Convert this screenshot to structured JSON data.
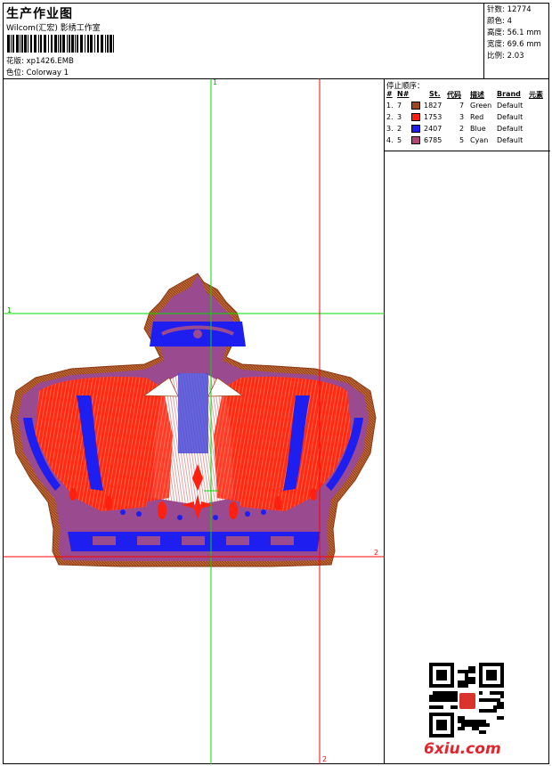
{
  "header": {
    "title": "生产作业图",
    "company": "Wilcom(汇宏) 影绣工作室",
    "design": "花版: xp1426.EMB",
    "colorway": "色位: Colorway 1"
  },
  "stats": [
    {
      "label": "针数",
      "value": "12774"
    },
    {
      "label": "颜色",
      "value": "4"
    },
    {
      "label": "高度",
      "value": "56.1 mm"
    },
    {
      "label": "宽度",
      "value": "69.6 mm"
    },
    {
      "label": "比例",
      "value": "2.03"
    }
  ],
  "guides": {
    "top_1": "1",
    "left_1": "1",
    "right_2": "2",
    "bottom_2": "2"
  },
  "stop_sequence": {
    "title": "停止顺序：",
    "headers": {
      "index": "#",
      "needle": "N#",
      "st": "St.",
      "code": "代码",
      "desc": "描述",
      "brand": "Brand",
      "element": "元素"
    },
    "rows": [
      {
        "index": "1.",
        "needle": "7",
        "color": "#a0461e",
        "st": "1827",
        "code": "7",
        "desc": "Green",
        "brand": "Default"
      },
      {
        "index": "2.",
        "needle": "3",
        "color": "#ff2010",
        "st": "1753",
        "code": "3",
        "desc": "Red",
        "brand": "Default"
      },
      {
        "index": "3.",
        "needle": "2",
        "color": "#1e1ef0",
        "st": "2407",
        "code": "2",
        "desc": "Blue",
        "brand": "Default"
      },
      {
        "index": "4.",
        "needle": "5",
        "color": "#b04878",
        "st": "6785",
        "code": "5",
        "desc": "Cyan",
        "brand": "Default"
      }
    ]
  },
  "watermark": "6xiu.com",
  "colors": {
    "outline": "#a0461e",
    "fill_red": "#ff2010",
    "fill_blue": "#1e1ef0",
    "satin_purple": "#9a4a8e",
    "guide_green": "#00dd00",
    "guide_red": "#ff0000"
  }
}
